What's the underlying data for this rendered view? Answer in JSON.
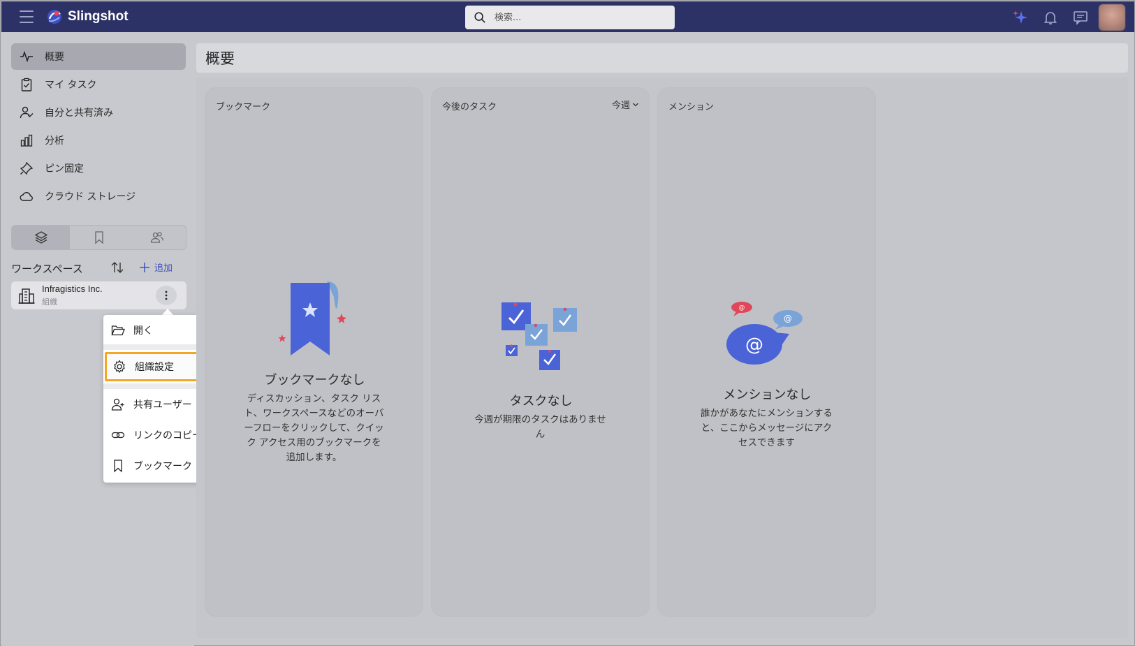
{
  "app": {
    "name": "Slingshot"
  },
  "search": {
    "placeholder": "検索..."
  },
  "sidebar": {
    "items": [
      {
        "label": "概要",
        "icon": "activity-icon",
        "active": true
      },
      {
        "label": "マイ タスク",
        "icon": "clipboard-check-icon"
      },
      {
        "label": "自分と共有済み",
        "icon": "user-check-icon"
      },
      {
        "label": "分析",
        "icon": "bar-chart-icon"
      },
      {
        "label": "ピン固定",
        "icon": "pin-icon"
      },
      {
        "label": "クラウド ストレージ",
        "icon": "cloud-icon"
      }
    ],
    "tabs": [
      "layers-icon",
      "bookmark-icon",
      "users-icon"
    ],
    "workspaces": {
      "title": "ワークスペース",
      "add_label": "追加",
      "items": [
        {
          "name": "Infragistics Inc.",
          "type": "組織"
        }
      ]
    }
  },
  "context_menu": {
    "items": [
      {
        "label": "開く",
        "icon": "folder-open-icon"
      },
      {
        "label": "組織設定",
        "icon": "gear-icon",
        "highlighted": true
      },
      {
        "label": "共有ユーザー",
        "icon": "user-plus-icon"
      },
      {
        "label": "リンクのコピー",
        "icon": "link-icon"
      },
      {
        "label": "ブックマーク",
        "icon": "bookmark-icon"
      }
    ]
  },
  "main": {
    "title": "概要",
    "cards": [
      {
        "title": "ブックマーク",
        "empty_title": "ブックマークなし",
        "empty_desc": "ディスカッション、タスク リスト、ワークスペースなどのオーバーフローをクリックして、クイック アクセス用のブックマークを追加します。"
      },
      {
        "title": "今後のタスク",
        "filter": "今週",
        "empty_title": "タスクなし",
        "empty_desc": "今週が期限のタスクはありません"
      },
      {
        "title": "メンション",
        "empty_title": "メンションなし",
        "empty_desc": "誰かがあなたにメンションすると、ここからメッセージにアクセスできます"
      }
    ]
  },
  "colors": {
    "topbar": "#2c3266",
    "accent": "#3e52c2",
    "highlight": "#f5a623",
    "illustration_blue": "#4a63d6",
    "illustration_light": "#7aa3d8",
    "illustration_red": "#e0475a"
  }
}
